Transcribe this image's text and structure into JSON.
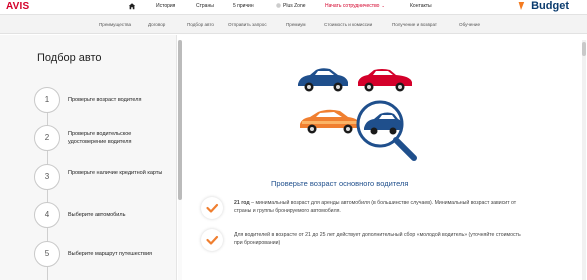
{
  "header": {
    "avis_logo": "AVIS",
    "budget_logo": "Budget",
    "nav": [
      {
        "label": "История"
      },
      {
        "label": "Страны"
      },
      {
        "label": "5 причин"
      },
      {
        "label": "Plus Zone"
      },
      {
        "label": "Начать сотрудничество"
      },
      {
        "label": "Контакты"
      }
    ]
  },
  "subnav": {
    "items": [
      {
        "label": "Преимущества"
      },
      {
        "label": "Договор"
      },
      {
        "label": "Подбор авто"
      },
      {
        "label": "Отправить запрос"
      },
      {
        "label": "Премиум"
      },
      {
        "label": "Стоимость и комиссии"
      },
      {
        "label": "Получение и возврат"
      },
      {
        "label": "Обучение"
      }
    ]
  },
  "sidebar": {
    "title": "Подбор авто",
    "steps": [
      {
        "num": "1",
        "label": "Проверьте возраст водителя"
      },
      {
        "num": "2",
        "label": "Проверьте водительское удостоверение водителя"
      },
      {
        "num": "3",
        "label": "Проверьте наличие кредитной карты"
      },
      {
        "num": "4",
        "label": "Выберите автомобиль"
      },
      {
        "num": "5",
        "label": "Выберите маршрут путешествия"
      }
    ]
  },
  "main": {
    "heading": "Проверьте возраст основного водителя",
    "requirements": [
      {
        "bold": "21 год",
        "text": " – минимальный возраст для аренды автомобиля (в большинстве случаев). Минимальный возраст зависит от страны и группы бронируемого автомобиля."
      },
      {
        "bold": "",
        "text": "Для водителей в возрасте от 21 до 25 лет действует дополнительный сбор «молодой водитель» (уточняйте стоимость при бронировании)"
      }
    ]
  },
  "colors": {
    "avis_red": "#d4002a",
    "budget_navy": "#0b3c6e",
    "heading_blue": "#1f4f8c",
    "check_orange": "#f07f30"
  }
}
